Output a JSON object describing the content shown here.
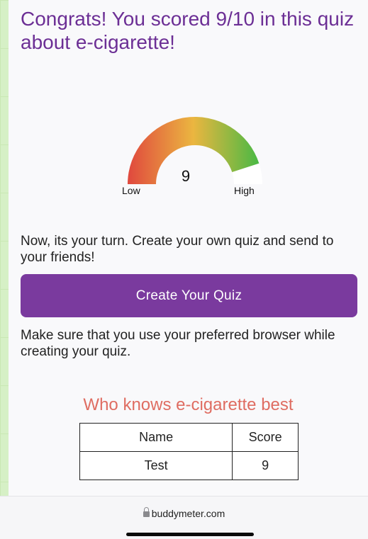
{
  "result": {
    "headline": "Congrats! You scored 9/10 in this quiz about e-cigarette!",
    "score": 9,
    "max_score": 10
  },
  "gauge": {
    "value_label": "9",
    "low_label": "Low",
    "high_label": "High",
    "colors": [
      "#e0483e",
      "#ebb640",
      "#49b944"
    ]
  },
  "cta": {
    "text": "Now, its your turn. Create your own quiz and send to your friends!",
    "button_label": "Create Your Quiz",
    "button_color": "#7a3a9e"
  },
  "note": "Make sure that you use your preferred browser while creating your quiz.",
  "leaderboard": {
    "title": "Who knows e-cigarette best",
    "columns": [
      "Name",
      "Score"
    ],
    "rows": [
      {
        "name": "Test",
        "score": "9"
      }
    ]
  },
  "browser": {
    "url": "buddymeter.com",
    "lock_icon": "lock-icon"
  },
  "colors": {
    "headline": "#6c2f95",
    "leaderboard_title": "#df6d62",
    "background": "#d6f0c6"
  }
}
